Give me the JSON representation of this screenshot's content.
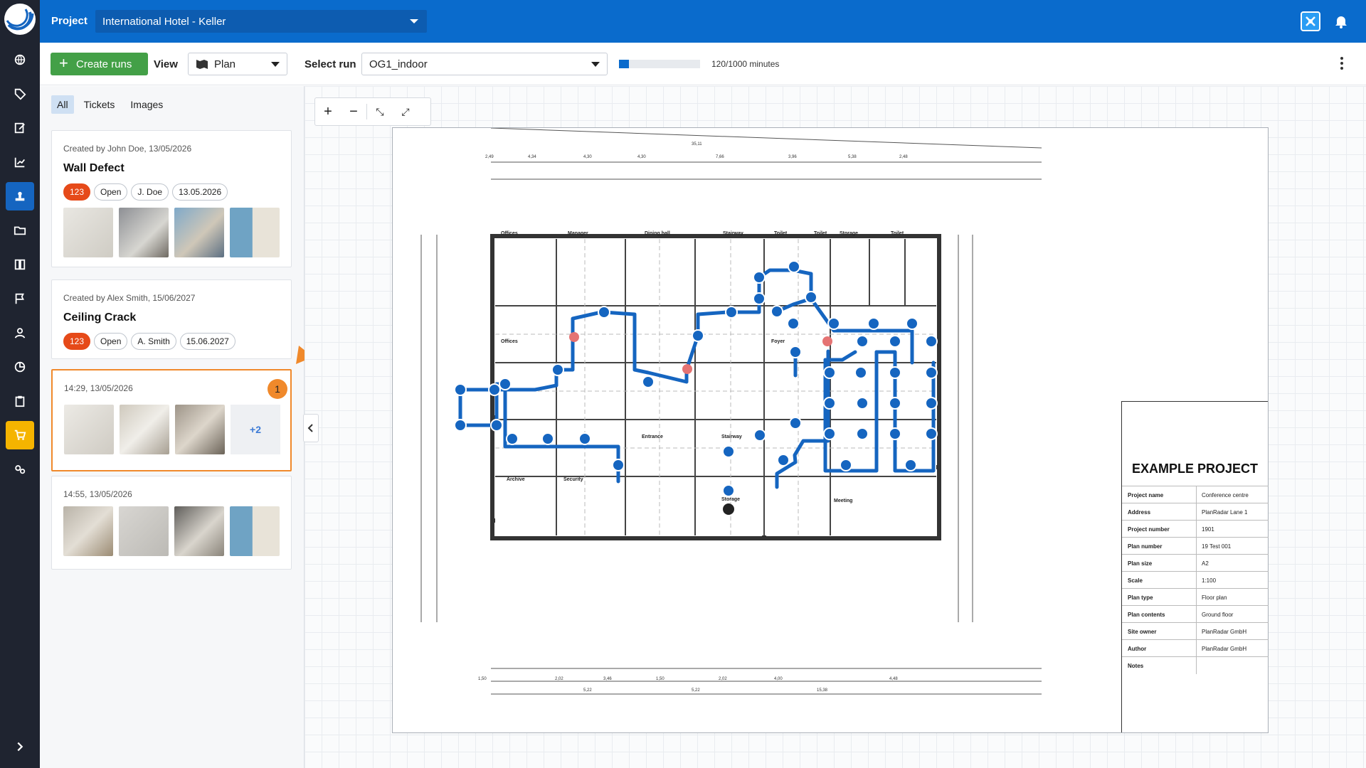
{
  "brand": {
    "accent": "#0a6bcc",
    "rail_bg": "#1f2430",
    "success": "#43a047",
    "highlight": "#f0892b",
    "route": "#1565c0",
    "issue": "#e57373"
  },
  "rail": {
    "items": [
      "globe-icon",
      "tag-icon",
      "edit-icon",
      "chart-icon",
      "stamp-icon",
      "folder-icon",
      "book-icon",
      "flag-icon",
      "user-icon",
      "pie-icon",
      "clipboard-icon",
      "cart-icon",
      "settings-icon"
    ],
    "expand_icon": "chevron-right-icon"
  },
  "header": {
    "project_label": "Project",
    "project_value": "International Hotel - Keller"
  },
  "toolbar": {
    "create_label": "Create runs",
    "view_label": "View",
    "view_value": "Plan",
    "run_label": "Select run",
    "run_value": "OG1_indoor",
    "progress_fraction": 0.12,
    "progress_text": "120/1000 minutes"
  },
  "tabs": [
    "All",
    "Tickets",
    "Images"
  ],
  "cards": [
    {
      "meta": "Created by John Doe, 13/05/2026",
      "title": "Wall Defect",
      "chips": [
        "123",
        "Open",
        "J. Doe",
        "13.05.2026"
      ]
    },
    {
      "meta": "Created by Alex Smith, 15/06/2027",
      "title": "Ceiling Crack",
      "chips": [
        "123",
        "Open",
        "A. Smith",
        "15.06.2027"
      ]
    },
    {
      "meta": "14:29, 13/05/2026",
      "badge": "1",
      "more": "+2"
    },
    {
      "meta": "14:55, 13/05/2026"
    }
  ],
  "plan": {
    "rooms": [
      "Offices",
      "Manager",
      "Dining hall",
      "Stairway",
      "Toilet",
      "Toilet",
      "Storage",
      "Toilet",
      "Offices",
      "Foyer",
      "Entrance",
      "Stairway",
      "Archive",
      "Security",
      "Meeting",
      "Storage"
    ],
    "dim_top": [
      "35,11",
      "2,49",
      "4,34",
      "4,30",
      "4,30",
      "7,66",
      "3,96",
      "5,38",
      "2,48"
    ],
    "dim_bottom": [
      "1,50",
      "2,02",
      "3,46",
      "1,50",
      "2,02",
      "4,00",
      "4,48",
      "5,22",
      "5,22",
      "15,38"
    ]
  },
  "title_block": {
    "heading": "EXAMPLE PROJECT",
    "rows": [
      {
        "k": "Project name",
        "v": "Conference centre"
      },
      {
        "k": "Address",
        "v": "PlanRadar Lane 1"
      },
      {
        "k": "Project number",
        "v": "1901"
      },
      {
        "k": "Plan number",
        "v": "19 Test 001"
      },
      {
        "k": "Plan size",
        "v": "A2"
      },
      {
        "k": "Scale",
        "v": "1:100"
      },
      {
        "k": "Plan type",
        "v": "Floor plan"
      },
      {
        "k": "Plan contents",
        "v": "Ground floor"
      },
      {
        "k": "Site owner",
        "v": "PlanRadar GmbH"
      },
      {
        "k": "Author",
        "v": "PlanRadar GmbH"
      },
      {
        "k": "Notes",
        "v": ""
      }
    ]
  }
}
